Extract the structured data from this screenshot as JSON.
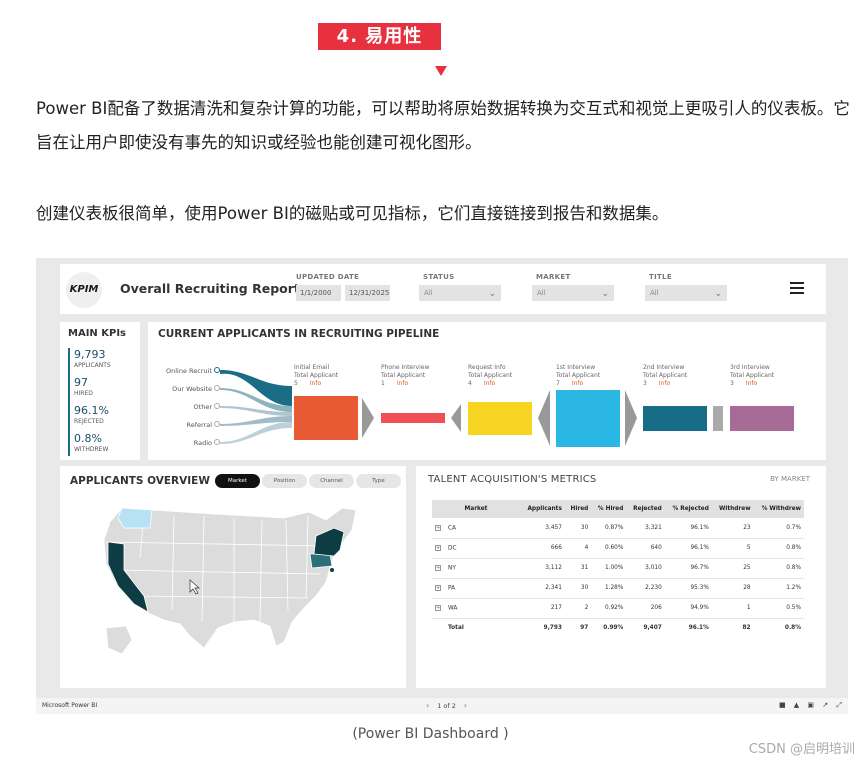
{
  "article": {
    "section_badge": "4. 易用性",
    "paragraph1": "Power BI配备了数据清洗和复杂计算的功能，可以帮助将原始数据转换为交互式和视觉上更吸引人的仪表板。它旨在让用户即使没有事先的知识或经验也能创建可视化图形。",
    "paragraph2": "创建仪表板很简单，使用Power BI的磁贴或可见指标，它们直接链接到报告和数据集。",
    "caption": "(Power BI Dashboard )",
    "watermark": "CSDN @启明培训"
  },
  "dashboard": {
    "logo_text": "KPIM",
    "report_title": "Overall Recruiting Report",
    "filters": {
      "updated_date_label": "UPDATED DATE",
      "date_from": "1/1/2000",
      "date_to": "12/31/2025",
      "status_label": "STATUS",
      "status_value": "All",
      "market_label": "MARKET",
      "market_value": "All",
      "title_label": "TITLE",
      "title_value": "All"
    },
    "kpis": {
      "title": "MAIN KPIs",
      "items": [
        {
          "value": "9,793",
          "label": "APPLICANTS"
        },
        {
          "value": "97",
          "label": "HIRED"
        },
        {
          "value": "96.1%",
          "label": "REJECTED"
        },
        {
          "value": "0.8%",
          "label": "WITHDREW"
        }
      ]
    },
    "pipeline": {
      "title": "CURRENT APPLICANTS IN RECRUITING PIPELINE",
      "sources": [
        "Online Recruit",
        "Our Website",
        "Other",
        "Referral",
        "Radio"
      ],
      "stages": [
        {
          "name": "Initial Email",
          "sub": "Total Applicant",
          "count": "5",
          "info": "Info",
          "color": "#e85a33"
        },
        {
          "name": "Phone Interview",
          "sub": "Total Applicant",
          "count": "1",
          "info": "Info",
          "color": "#f04f56"
        },
        {
          "name": "Request Info",
          "sub": "Total Applicant",
          "count": "4",
          "info": "Info",
          "color": "#f5d422"
        },
        {
          "name": "1st Interview",
          "sub": "Total Applicant",
          "count": "7",
          "info": "Info",
          "color": "#2bb7e3"
        },
        {
          "name": "2nd Interview",
          "sub": "Total Applicant",
          "count": "3",
          "info": "Info",
          "color": "#176c87"
        },
        {
          "name": "3rd Interview",
          "sub": "Total Applicant",
          "count": "3",
          "info": "Info",
          "color": "#a86b98"
        }
      ]
    },
    "overview": {
      "title": "APPLICANTS OVERVIEW",
      "tabs": [
        "Market",
        "Position",
        "Channel",
        "Type"
      ],
      "active_tab": "Market"
    },
    "metrics": {
      "title": "TALENT ACQUISITION'S METRICS",
      "subtitle": "BY MARKET",
      "columns": [
        "Market",
        "Applicants",
        "Hired",
        "% Hired",
        "Rejected",
        "% Rejected",
        "Withdrew",
        "% Withdrew"
      ],
      "rows": [
        [
          "CA",
          "3,457",
          "30",
          "0.87%",
          "3,321",
          "96.1%",
          "23",
          "0.7%"
        ],
        [
          "DC",
          "666",
          "4",
          "0.60%",
          "640",
          "96.1%",
          "5",
          "0.8%"
        ],
        [
          "NY",
          "3,112",
          "31",
          "1.00%",
          "3,010",
          "96.7%",
          "25",
          "0.8%"
        ],
        [
          "PA",
          "2,341",
          "30",
          "1.28%",
          "2,230",
          "95.3%",
          "28",
          "1.2%"
        ],
        [
          "WA",
          "217",
          "2",
          "0.92%",
          "206",
          "94.9%",
          "1",
          "0.5%"
        ]
      ],
      "total": [
        "Total",
        "9,793",
        "97",
        "0.99%",
        "9,407",
        "96.1%",
        "82",
        "0.8%"
      ]
    },
    "footer": {
      "brand": "Microsoft Power BI",
      "pager": "1 of 2"
    }
  }
}
